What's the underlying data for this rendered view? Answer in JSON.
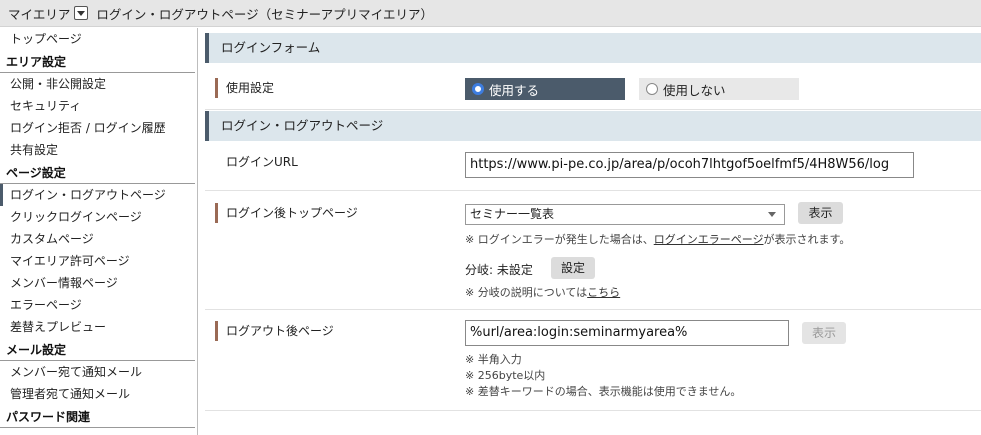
{
  "topbar": {
    "area_label": "マイエリア",
    "page_title": "ログイン・ログアウトページ（セミナーアプリマイエリア）"
  },
  "sidebar": {
    "top_item": "トップページ",
    "sections": [
      {
        "heading": "エリア設定",
        "items": [
          "公開・非公開設定",
          "セキュリティ",
          "ログイン拒否 / ログイン履歴",
          "共有設定"
        ]
      },
      {
        "heading": "ページ設定",
        "items": [
          "ログイン・ログアウトページ",
          "クリックログインページ",
          "カスタムページ",
          "マイエリア許可ページ",
          "メンバー情報ページ",
          "エラーページ",
          "差替えプレビュー"
        ]
      },
      {
        "heading": "メール設定",
        "items": [
          "メンバー宛て通知メール",
          "管理者宛て通知メール"
        ]
      },
      {
        "heading": "パスワード関連",
        "items": []
      }
    ],
    "active_item": "ログイン・ログアウトページ"
  },
  "login_form": {
    "section_title": "ログインフォーム",
    "usage_label": "使用設定",
    "radio_on": "使用する",
    "radio_off": "使用しない",
    "selected": "使用する"
  },
  "login_logout": {
    "section_title": "ログイン・ログアウトページ",
    "login_url_label": "ログインURL",
    "login_url_value": "https://www.pi-pe.co.jp/area/p/ocoh7lhtgof5oelfmf5/4H8W56/log",
    "after_login_label": "ログイン後トップページ",
    "after_login_select": "セミナー一覧表",
    "show_button": "表示",
    "error_note_prefix": "※ ログインエラーが発生した場合は、",
    "error_note_link": "ログインエラーページ",
    "error_note_suffix": "が表示されます。",
    "branch_label": "分岐: 未設定",
    "branch_button": "設定",
    "branch_note_prefix": "※ 分岐の説明については",
    "branch_note_link": "こちら",
    "after_logout_label": "ログアウト後ページ",
    "after_logout_value": "%url/area:login:seminarmyarea%",
    "show_button_disabled": "表示",
    "logout_notes": [
      "※ 半角入力",
      "※ 256byte以内",
      "※ 差替キーワードの場合、表示機能は使用できません。"
    ]
  },
  "colors": {
    "section_bg": "#dce6ec",
    "accent_dark": "#4b5b6b",
    "label_bar": "#9a6a55",
    "radio_selected": "#3d7de0"
  }
}
